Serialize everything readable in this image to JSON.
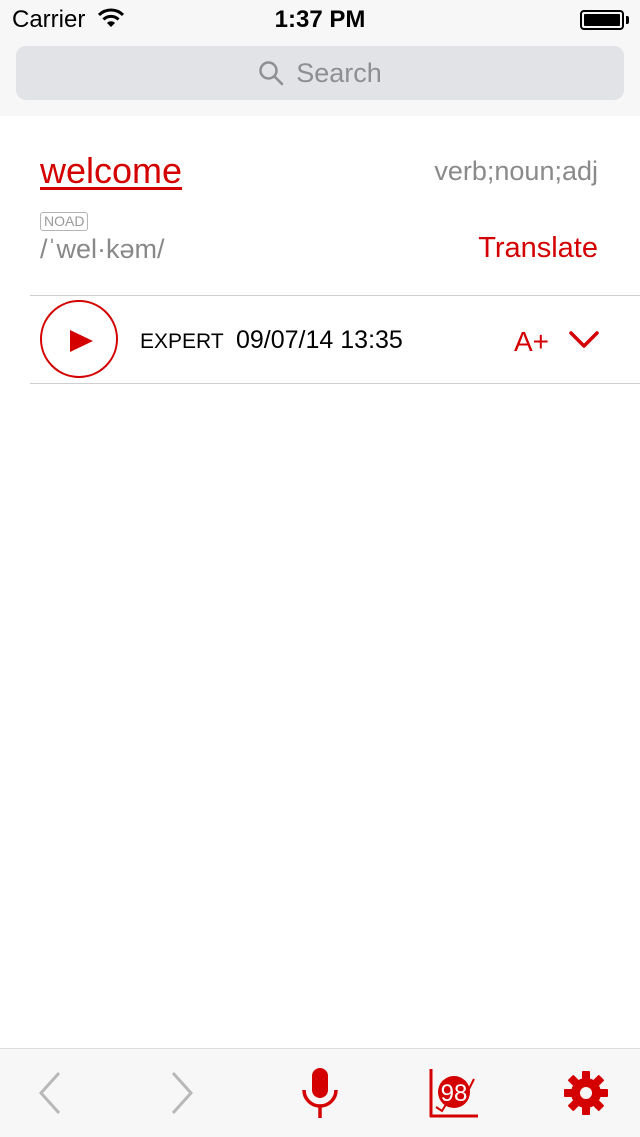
{
  "status_bar": {
    "carrier": "Carrier",
    "time": "1:37 PM"
  },
  "search": {
    "placeholder": "Search",
    "icon": "search-icon"
  },
  "entry": {
    "word": "welcome",
    "parts_of_speech": "verb;noun;adj",
    "source_badge": "NOAD",
    "pronunciation": "/ˈwel·kəm/",
    "translate_label": "Translate"
  },
  "recording": {
    "level": "EXPERT",
    "datetime": "09/07/14 13:35",
    "grade": "A+"
  },
  "tabbar": {
    "items": [
      {
        "icon": "back-arrow-icon",
        "enabled": false
      },
      {
        "icon": "forward-arrow-icon",
        "enabled": false
      },
      {
        "icon": "microphone-icon",
        "enabled": true
      },
      {
        "icon": "score-chart-icon",
        "label": "98",
        "enabled": true
      },
      {
        "icon": "gear-icon",
        "enabled": true
      }
    ]
  },
  "colors": {
    "accent": "#d40000",
    "muted": "#8a8a8a",
    "divider": "#cfcfcf",
    "bar_bg": "#f7f7f7"
  }
}
